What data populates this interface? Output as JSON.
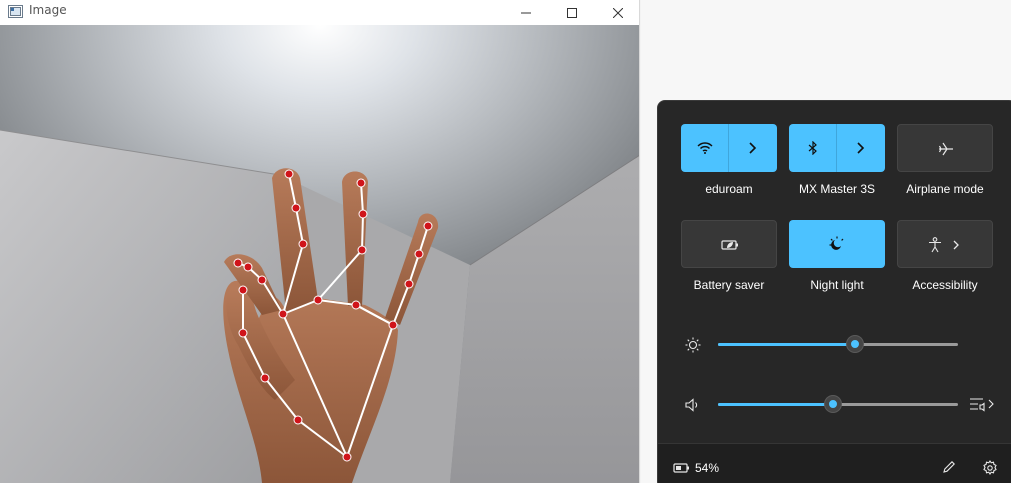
{
  "window": {
    "title": "Image",
    "controls": {
      "minimize": "—",
      "maximize": "☐",
      "close": "✕"
    }
  },
  "quick_settings": {
    "accent_color": "#4cc2ff",
    "tiles": [
      {
        "label": "eduroam",
        "icon": "wifi-icon",
        "on": true,
        "has_chevron": true
      },
      {
        "label": "MX Master 3S",
        "icon": "bluetooth-icon",
        "on": true,
        "has_chevron": true
      },
      {
        "label": "Airplane mode",
        "icon": "airplane-icon",
        "on": false,
        "has_chevron": false
      },
      {
        "label": "Battery saver",
        "icon": "battery-saver-icon",
        "on": false,
        "has_chevron": false
      },
      {
        "label": "Night light",
        "icon": "night-light-icon",
        "on": true,
        "has_chevron": false
      },
      {
        "label": "Accessibility",
        "icon": "accessibility-icon",
        "on": false,
        "has_chevron": true
      }
    ],
    "brightness": {
      "icon": "brightness-icon",
      "level": 0.57
    },
    "volume": {
      "icon": "speaker-icon",
      "level": 0.48,
      "output_icon": "audio-output-icon"
    },
    "battery": {
      "icon": "battery-icon",
      "percent_text": "54%"
    },
    "footer_icons": [
      "edit-icon",
      "settings-icon"
    ]
  }
}
